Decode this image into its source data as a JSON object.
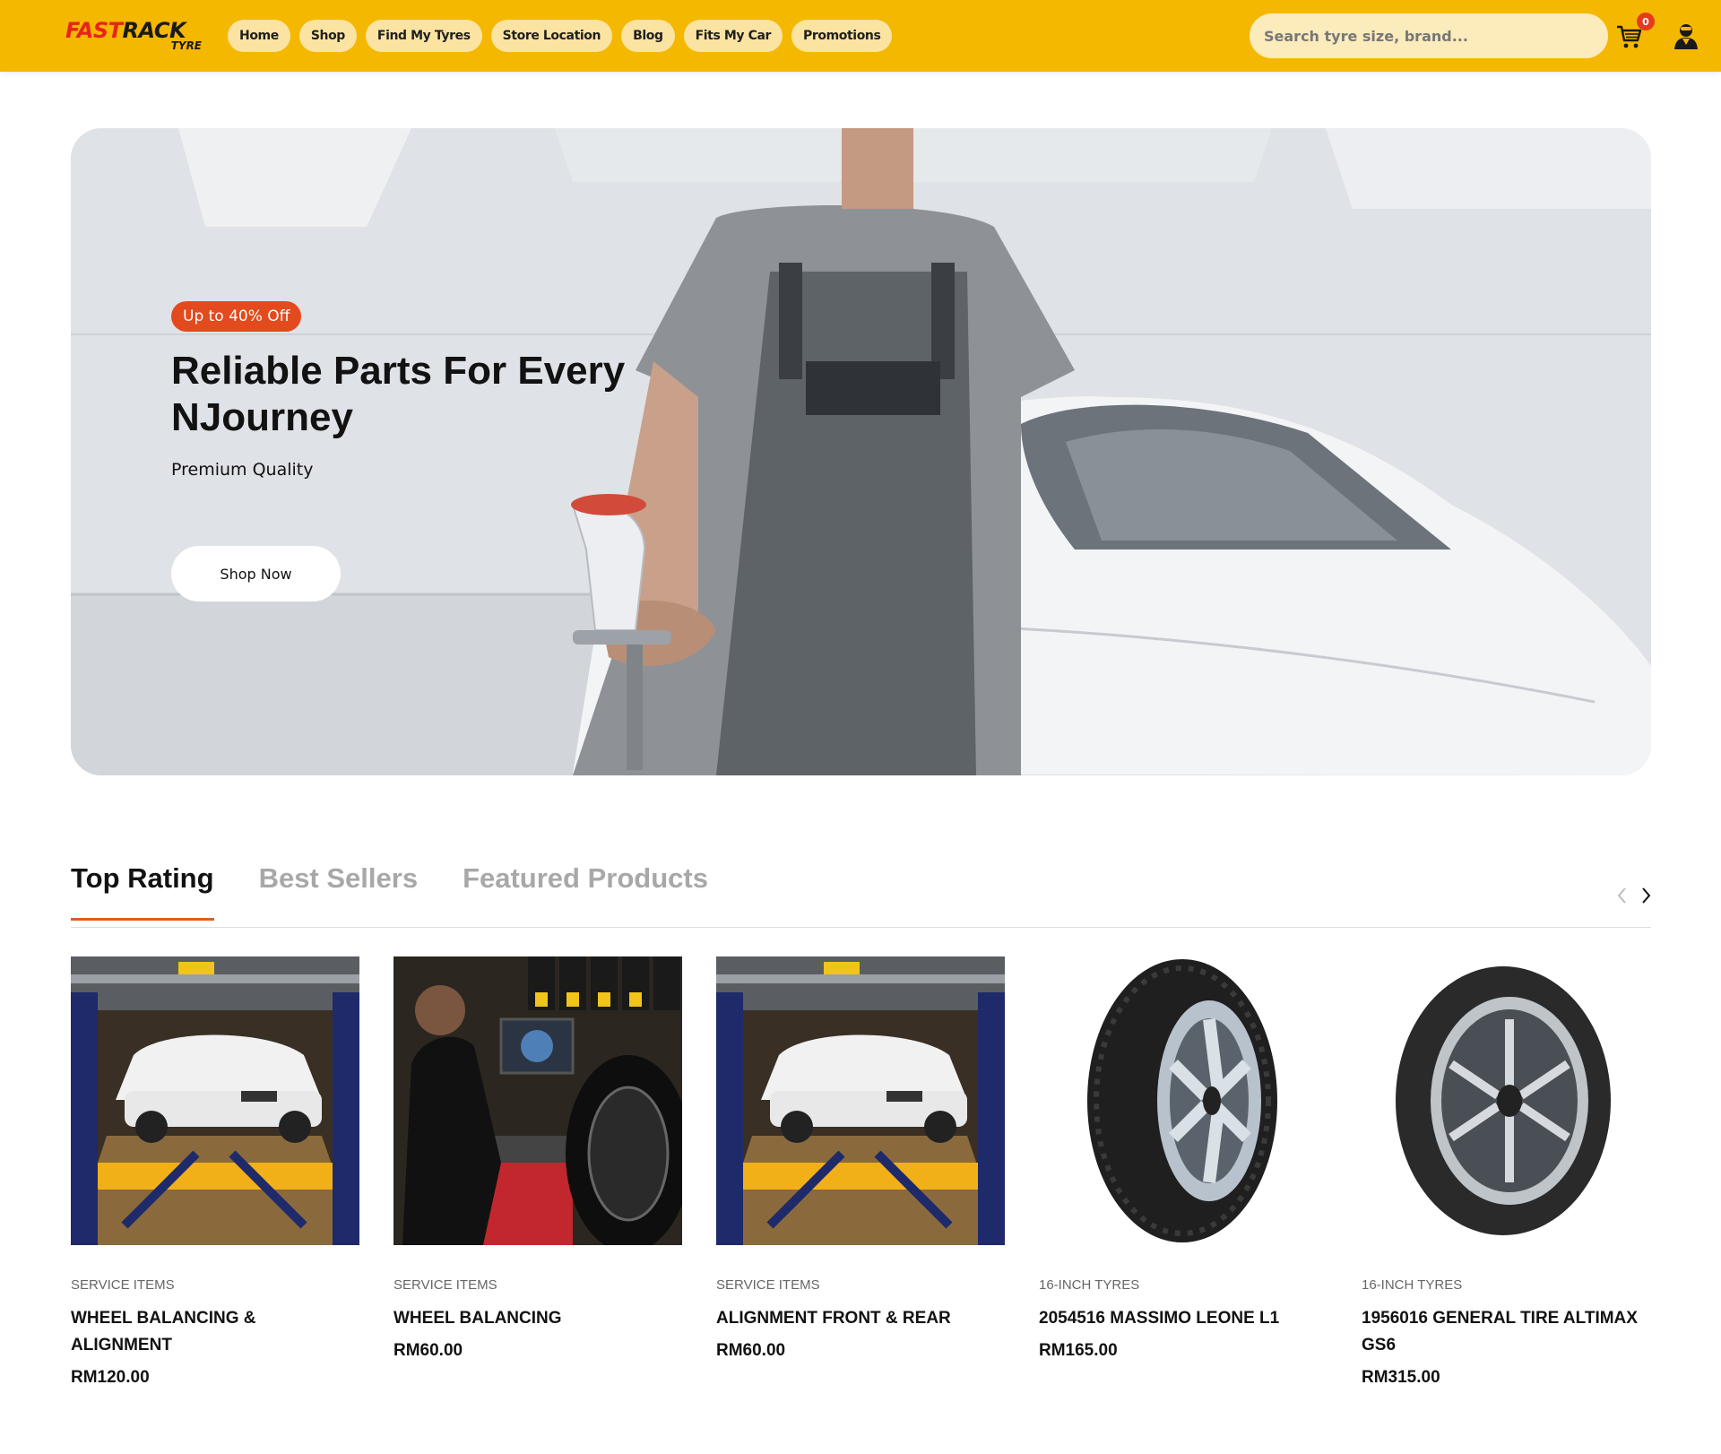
{
  "header": {
    "logo": {
      "text_fast": "FAST",
      "text_rack": "RACK",
      "text_sub": "TYRE"
    },
    "nav": [
      {
        "label": "Home"
      },
      {
        "label": "Shop"
      },
      {
        "label": "Find My Tyres"
      },
      {
        "label": "Store Location"
      },
      {
        "label": "Blog"
      },
      {
        "label": "Fits My Car"
      },
      {
        "label": "Promotions"
      }
    ],
    "search": {
      "placeholder": "Search tyre size, brand..."
    },
    "cart": {
      "icon": "cart-icon",
      "count": "0"
    },
    "user": {
      "icon": "user-icon"
    }
  },
  "hero": {
    "badge": "Up to 40% Off",
    "title": "Reliable Parts For Every NJourney",
    "subtitle": "Premium Quality",
    "button": "Shop Now"
  },
  "tabs": [
    {
      "label": "Top Rating",
      "active": true
    },
    {
      "label": "Best Sellers",
      "active": false
    },
    {
      "label": "Featured Products",
      "active": false
    }
  ],
  "carousel": {
    "prev_icon": "chevron-left-icon",
    "next_icon": "chevron-right-icon"
  },
  "products": [
    {
      "category": "SERVICE ITEMS",
      "name": "WHEEL BALANCING & ALIGNMENT",
      "price": "RM120.00"
    },
    {
      "category": "SERVICE ITEMS",
      "name": "WHEEL BALANCING",
      "price": "RM60.00"
    },
    {
      "category": "SERVICE ITEMS",
      "name": "ALIGNMENT FRONT & REAR",
      "price": "RM60.00"
    },
    {
      "category": "16-INCH TYRES",
      "name": "2054516 MASSIMO LEONE L1",
      "price": "RM165.00"
    },
    {
      "category": "16-INCH TYRES",
      "name": "1956016 GENERAL TIRE ALTIMAX GS6",
      "price": "RM315.00"
    }
  ],
  "colors": {
    "brand_yellow": "#f5b800",
    "accent_orange": "#e25d1f",
    "badge_red": "#e34a1e",
    "logo_red": "#e8231c"
  }
}
